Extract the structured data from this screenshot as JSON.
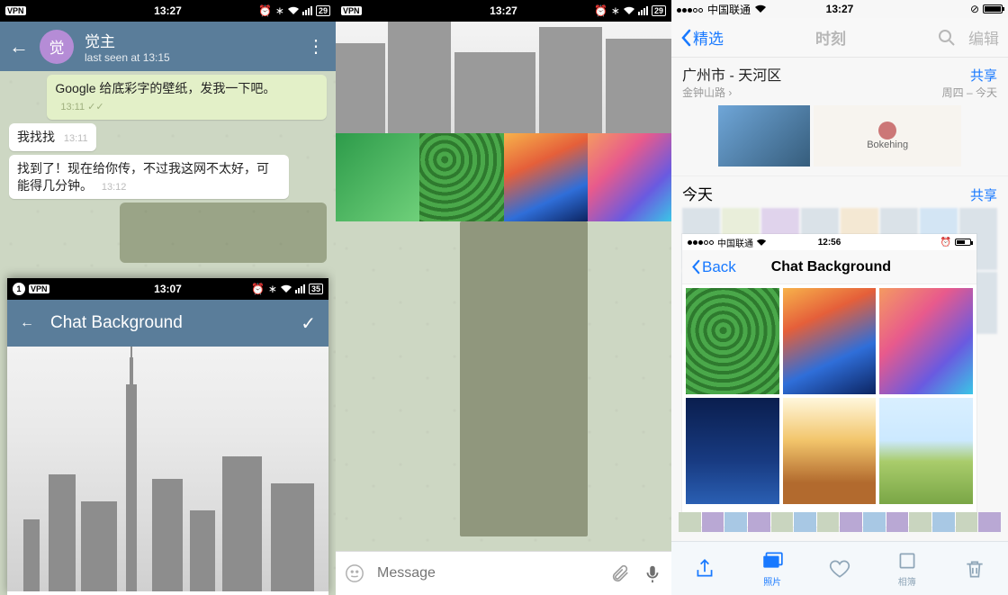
{
  "col1": {
    "status": {
      "time": "13:27",
      "vpn": "VPN",
      "battery": "29"
    },
    "header": {
      "avatar_letter": "觉",
      "name": "觉主",
      "last_seen": "last seen at 13:15"
    },
    "messages": {
      "m1_text": "Google 给底彩字的壁纸，发我一下吧。",
      "m1_time": "13:11",
      "m2_text": "我找找",
      "m2_time": "13:11",
      "m3_text": "找到了！现在给你传，不过我这网不太好，可能得几分钟。",
      "m3_time": "13:12"
    },
    "overlay": {
      "status_time": "13:07",
      "status_battery": "35",
      "title": "Chat Background"
    }
  },
  "col2": {
    "status": {
      "time": "13:27",
      "vpn": "VPN",
      "battery": "29"
    },
    "thumbs": [
      "green",
      "grass",
      "space",
      "poly"
    ],
    "compose_placeholder": "Message"
  },
  "col3": {
    "status": {
      "carrier": "中国联通",
      "time": "13:27"
    },
    "nav": {
      "back": "精选",
      "title_blur": "时刻",
      "search": "编辑"
    },
    "moments": {
      "title": "广州市 - 天河区",
      "share": "共享",
      "sub_left": "金钟山路",
      "sub_right": "周四 – 今天",
      "card_label": "Bokehing"
    },
    "today": {
      "title": "今天",
      "share": "共享"
    },
    "overlay": {
      "status_carrier": "中国联通",
      "status_time": "12:56",
      "back": "Back",
      "title": "Chat Background",
      "cells": [
        "grass",
        "space",
        "poly",
        "night",
        "autumn",
        "field"
      ]
    },
    "toolbar": {
      "photos": "照片",
      "albums": "相簿"
    }
  }
}
